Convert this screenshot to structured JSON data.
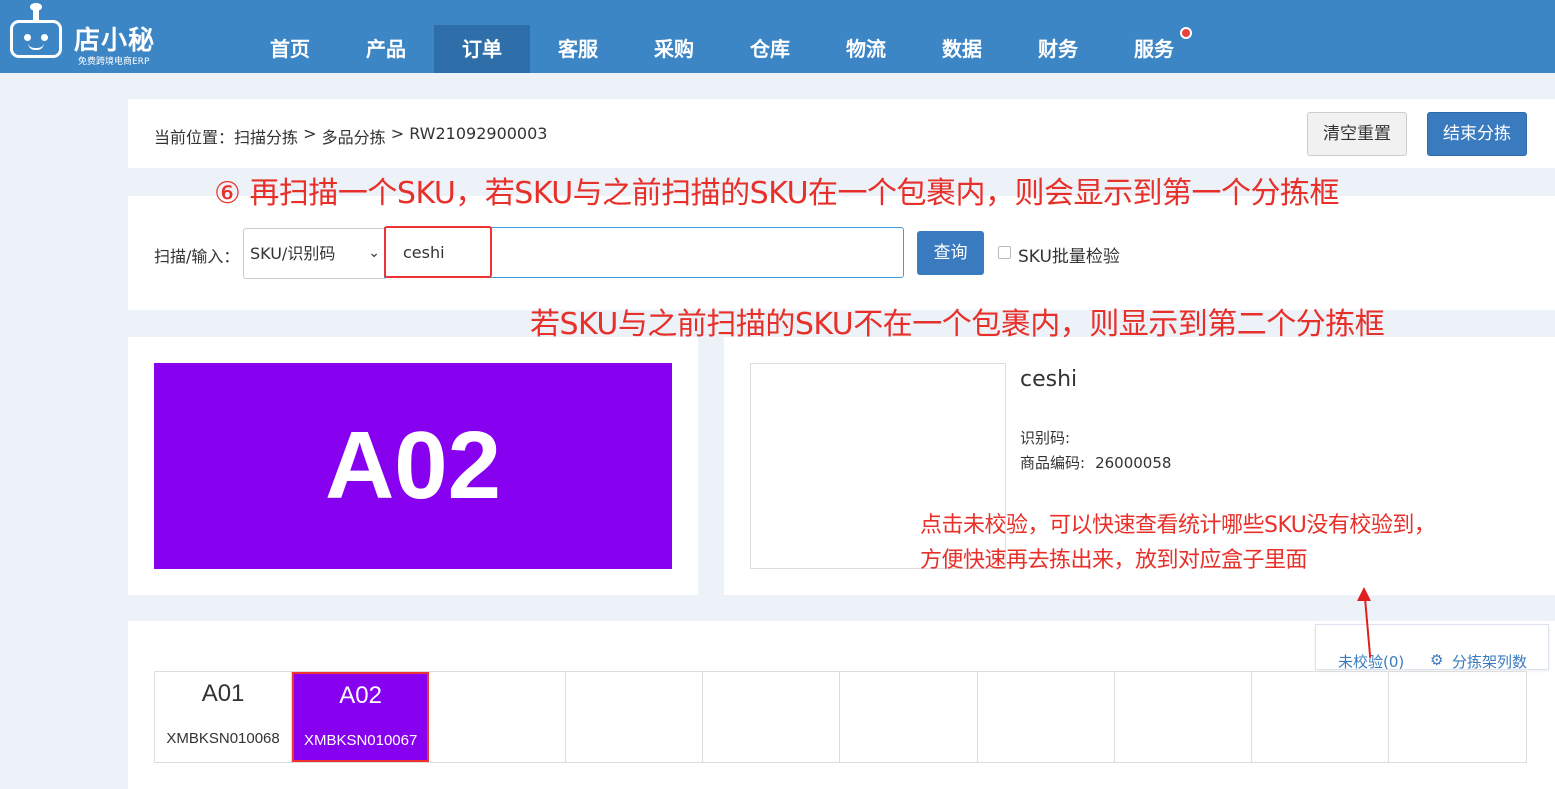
{
  "app": {
    "name": "店小秘",
    "slogan": "免费跨境电商ERP"
  },
  "nav": {
    "items": [
      "首页",
      "产品",
      "订单",
      "客服",
      "采购",
      "仓库",
      "物流",
      "数据",
      "财务",
      "服务"
    ],
    "active": "订单"
  },
  "breadcrumb": {
    "label": "当前位置：",
    "parts": [
      "扫描分拣",
      " > ",
      "多品分拣",
      " > ",
      "RW21092900003"
    ]
  },
  "toolbar": {
    "clear_label": "清空重置",
    "end_label": "结束分拣"
  },
  "scan": {
    "label": "扫描/输入：",
    "select_value": "SKU/识别码",
    "input_value": "ceshi",
    "query_label": "查询",
    "batch_check_label": "SKU批量检验"
  },
  "slot": {
    "current": "A02"
  },
  "product": {
    "name": "ceshi",
    "id_code_label": "识别码:",
    "sku_label": "商品编码:",
    "sku_value": "26000058"
  },
  "unverified": {
    "link": "未校验(0)",
    "shelf_columns": "分拣架列数"
  },
  "shelf_cells": [
    {
      "title": "A01",
      "sub": "XMBKSN010068",
      "active": false
    },
    {
      "title": "A02",
      "sub": "XMBKSN010067",
      "active": true
    },
    {
      "title": "",
      "sub": "",
      "active": false
    },
    {
      "title": "",
      "sub": "",
      "active": false
    },
    {
      "title": "",
      "sub": "",
      "active": false
    },
    {
      "title": "",
      "sub": "",
      "active": false
    },
    {
      "title": "",
      "sub": "",
      "active": false
    },
    {
      "title": "",
      "sub": "",
      "active": false
    },
    {
      "title": "",
      "sub": "",
      "active": false
    },
    {
      "title": "",
      "sub": "",
      "active": false
    }
  ],
  "annotations": {
    "step6": "⑥ 再扫描一个SKU，若SKU与之前扫描的SKU在一个包裹内，则会显示到第一个分拣框",
    "else": "若SKU与之前扫描的SKU不在一个包裹内，则显示到第二个分拣框",
    "tip": "点击未校验，可以快速查看统计哪些SKU没有校验到，\n方便快速再去拣出来，放到对应盒子里面"
  },
  "colors": {
    "nav_bg": "#3d86c6",
    "accent": "#3a7bc0",
    "slot": "#8800f0",
    "annotation": "#e8302a"
  }
}
